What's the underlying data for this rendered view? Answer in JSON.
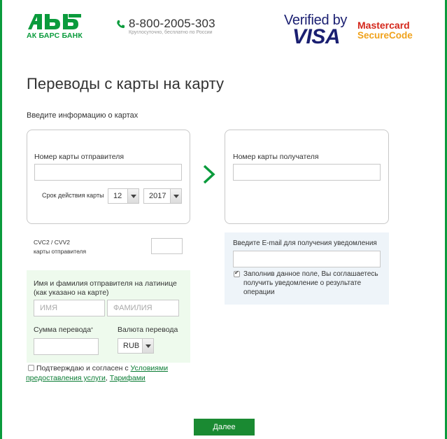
{
  "header": {
    "bank_name": "АК БАРС БАНК",
    "phone": "8-800-2005-303",
    "phone_note": "Круглосуточно, бесплатно по России",
    "visa_verified_text": "Verified by",
    "visa_logo": "VISA",
    "mastercard_line1": "Mastercard",
    "mastercard_line2": "SecureCode"
  },
  "page": {
    "title": "Переводы с карты на карту",
    "section_label": "Введите информацию о картах"
  },
  "sender_card": {
    "label": "Номер карты отправителя",
    "value": "",
    "expiry_label": "Срок действия карты",
    "expiry_month": "12",
    "expiry_year": "2017"
  },
  "recipient_card": {
    "label": "Номер карты получателя",
    "value": ""
  },
  "cvc": {
    "label_line1": "CVC2 / CVV2",
    "label_line2": "карты отправителя",
    "value": ""
  },
  "sender_name": {
    "label_line1": "Имя и фамилия отправителя на латинице",
    "label_line2": "(как указано на карте)",
    "first_name_placeholder": "ИМЯ",
    "last_name_placeholder": "ФАМИЛИЯ"
  },
  "amount": {
    "label": "Сумма перевода",
    "required_mark": "*",
    "value": ""
  },
  "currency": {
    "label": "Валюта перевода",
    "value": "RUB"
  },
  "email": {
    "label": "Введите E-mail для получения уведомления",
    "value": "",
    "note": "Заполнив данное поле, Вы соглашаетесь получить уведомление о результате операции"
  },
  "agreement": {
    "text_before": "Подтверждаю и согласен с ",
    "terms_link": "Условиями предоставления услуги",
    "separator": ", ",
    "tariffs_link": "Тарифами"
  },
  "actions": {
    "submit_label": "Далее"
  },
  "colors": {
    "brand_green": "#0a9b3c",
    "button_green": "#1a8a32",
    "visa_blue": "#1a1f71",
    "mastercard_red": "#d4271b",
    "mastercard_orange": "#f0a21b"
  }
}
